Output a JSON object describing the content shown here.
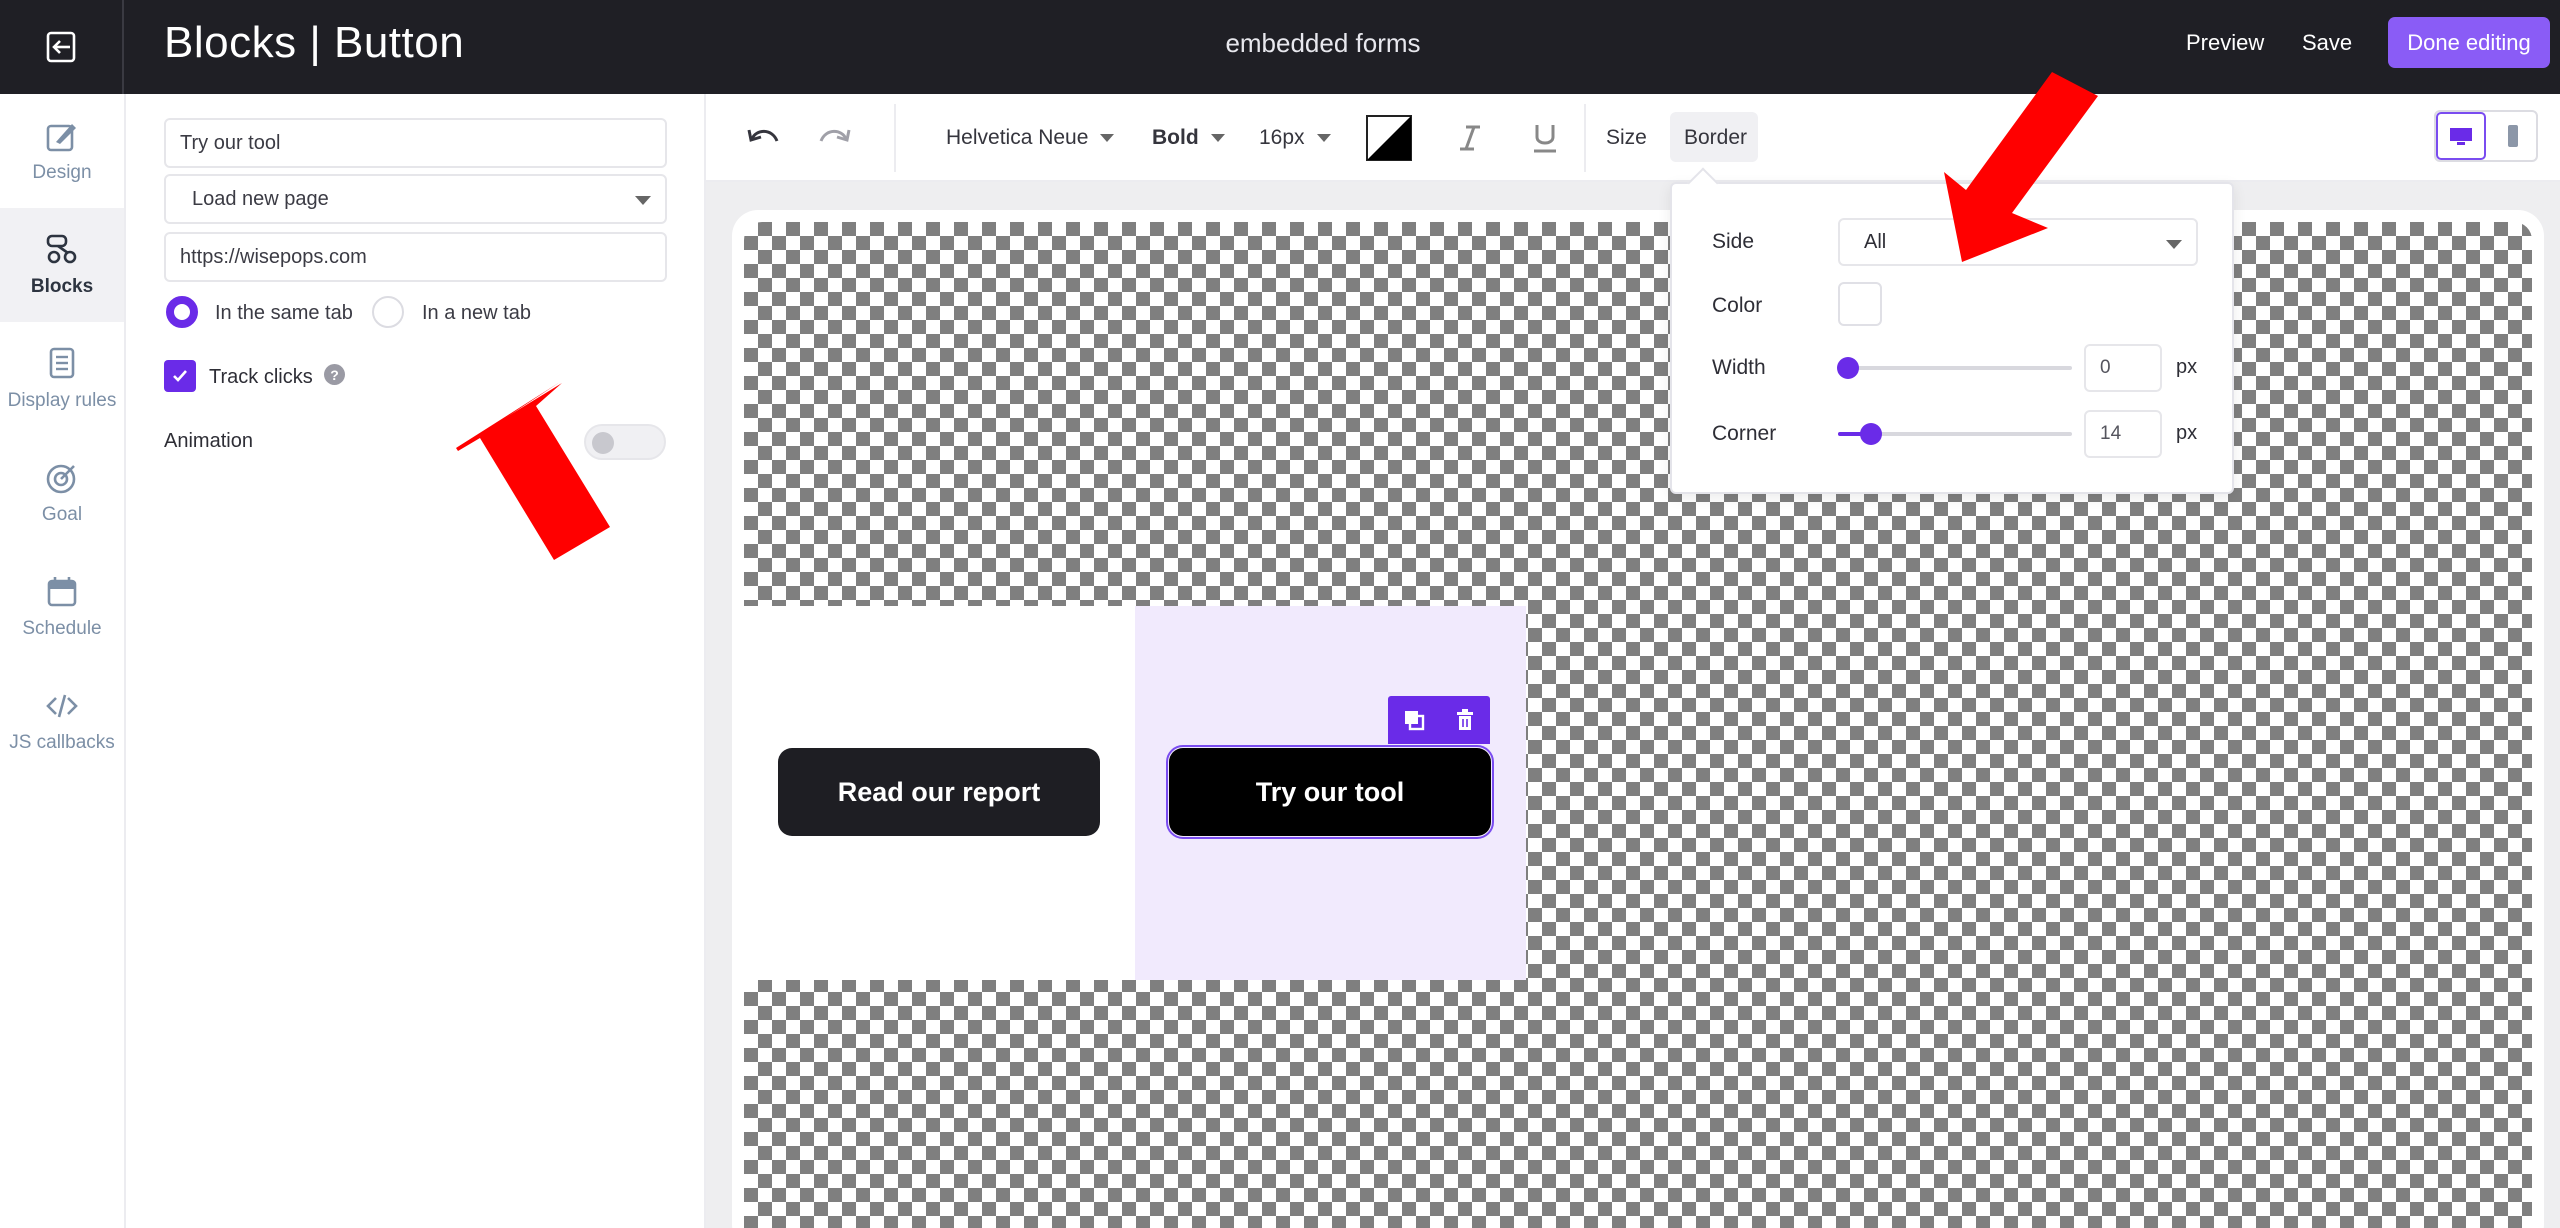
{
  "header": {
    "title": "Blocks | Button",
    "form_name": "embedded forms",
    "preview_label": "Preview",
    "save_label": "Save",
    "done_label": "Done editing"
  },
  "leftnav": {
    "items": [
      {
        "label": "Design",
        "icon": "brush-icon"
      },
      {
        "label": "Blocks",
        "icon": "blocks-icon",
        "active": true
      },
      {
        "label": "Display rules",
        "icon": "document-icon"
      },
      {
        "label": "Goal",
        "icon": "target-icon"
      },
      {
        "label": "Schedule",
        "icon": "calendar-icon"
      },
      {
        "label": "JS callbacks",
        "icon": "code-icon"
      }
    ]
  },
  "settings": {
    "button_text": "Try our tool",
    "action_select": "Load new page",
    "url": "https://wisepops.com",
    "radio_same_tab": "In the same tab",
    "radio_new_tab": "In a new tab",
    "track_clicks": "Track clicks",
    "help": "?",
    "animation": "Animation"
  },
  "toolbar": {
    "font": "Helvetica Neue",
    "weight": "Bold",
    "size": "16px",
    "size_tab": "Size",
    "border_tab": "Border"
  },
  "border_popover": {
    "side_label": "Side",
    "side_value": "All",
    "color_label": "Color",
    "color_value": "#ffffff",
    "width_label": "Width",
    "width_value": "0",
    "corner_label": "Corner",
    "corner_value": "14",
    "unit": "px"
  },
  "canvas": {
    "button1": "Read our report",
    "button2": "Try our tool"
  },
  "colors": {
    "accent": "#6a2be8",
    "header_bg": "#1f1f25",
    "done_button": "#8a5cf6",
    "annotation_arrow": "#ff0000"
  }
}
